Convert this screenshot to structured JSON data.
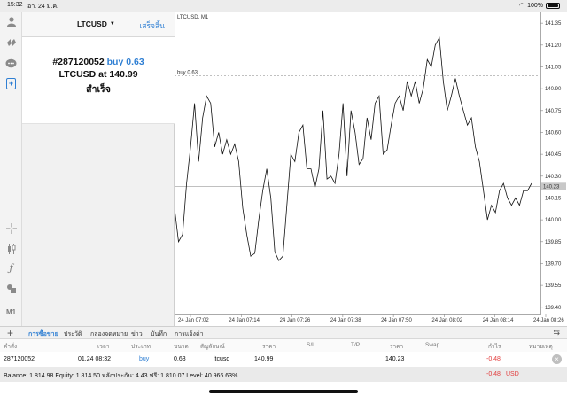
{
  "status": {
    "time": "15:32",
    "date": "อา. 24 ม.ค.",
    "battery": "100%"
  },
  "toolbar": {
    "icons": [
      "account-icon",
      "trade-arrows-icon",
      "chat-icon",
      "new-order-icon",
      "crosshair-icon",
      "candles-icon",
      "function-icon",
      "objects-icon"
    ],
    "timeframe": "M1"
  },
  "panel": {
    "symbol": "LTCUSD",
    "done_label": "เสร็จสิ้น",
    "result": {
      "ticket": "#287120052",
      "action": "buy 0.63",
      "symbol_at": "LTCUSD at",
      "price": "140.99",
      "status": "สำเร็จ"
    }
  },
  "chart": {
    "title": "LTCUSD, M1",
    "order_line_label": "buy 0.63",
    "current_price_label": "140.23",
    "colors": {
      "line": "#111111",
      "grid": "#aaaaaa",
      "price_line": "#9a9a9a",
      "price_tag": "#c8c8c8"
    }
  },
  "chart_data": {
    "type": "line",
    "title": "LTCUSD, M1",
    "x_ticks": [
      "24 Jan 07:02",
      "24 Jan 07:14",
      "24 Jan 07:26",
      "24 Jan 07:38",
      "24 Jan 07:50",
      "24 Jan 08:02",
      "24 Jan 08:14",
      "24 Jan 08:26"
    ],
    "y_ticks": [
      141.35,
      141.2,
      141.05,
      140.9,
      140.75,
      140.6,
      140.45,
      140.3,
      140.15,
      140.0,
      139.85,
      139.7,
      139.55,
      139.4
    ],
    "ylim": [
      139.35,
      141.43
    ],
    "order_level": 140.99,
    "current_price": 140.23,
    "values": [
      140.08,
      139.85,
      139.9,
      140.25,
      140.5,
      140.8,
      140.4,
      140.7,
      140.85,
      140.8,
      140.5,
      140.6,
      140.45,
      140.55,
      140.45,
      140.52,
      140.4,
      140.08,
      139.9,
      139.75,
      139.77,
      140.0,
      140.2,
      140.35,
      140.15,
      139.78,
      139.72,
      139.75,
      140.1,
      140.45,
      140.4,
      140.6,
      140.65,
      140.35,
      140.35,
      140.22,
      140.35,
      140.75,
      140.28,
      140.3,
      140.25,
      140.45,
      140.8,
      140.3,
      140.75,
      140.6,
      140.38,
      140.42,
      140.7,
      140.55,
      140.8,
      140.85,
      140.45,
      140.48,
      140.65,
      140.8,
      140.85,
      140.75,
      140.95,
      140.85,
      140.95,
      140.8,
      140.9,
      141.1,
      141.05,
      141.2,
      141.25,
      140.95,
      140.75,
      140.85,
      140.97,
      140.85,
      140.75,
      140.65,
      140.7,
      140.5,
      140.4,
      140.2,
      140.0,
      140.1,
      140.05,
      140.2,
      140.25,
      140.15,
      140.1,
      140.15,
      140.1,
      140.2,
      140.2,
      140.25
    ]
  },
  "tabs": {
    "items": [
      {
        "label": "การซื้อขาย",
        "active": true
      },
      {
        "label": "ประวัติ",
        "active": false
      },
      {
        "label": "กล่องจดหมาย",
        "active": false
      },
      {
        "label": "ข่าว",
        "active": false
      },
      {
        "label": "บันทึก",
        "active": false
      },
      {
        "label": "การแจ้งค่า",
        "active": false
      }
    ]
  },
  "table": {
    "headers": [
      "คำสั่ง",
      "เวลา",
      "ประเภท",
      "ขนาด",
      "สัญลักษณ์",
      "ราคา",
      "S/L",
      "T/P",
      "ราคา",
      "Swap",
      "กำไร",
      "หมายเหตุ"
    ],
    "row": {
      "ticket": "287120052",
      "time": "01.24 08:32",
      "type": "buy",
      "size": "0.63",
      "symbol": "ltcusd",
      "open_price": "140.99",
      "sl": "",
      "tp": "",
      "price": "140.23",
      "swap": "",
      "profit": "-0.48",
      "comment": ""
    }
  },
  "balance": {
    "text": "Balance: 1 814.98 Equity: 1 814.50 หลักประกัน: 4.43 ฟรี: 1 810.07 Level: 40 966.63%",
    "profit": "-0.48",
    "currency": "USD"
  }
}
